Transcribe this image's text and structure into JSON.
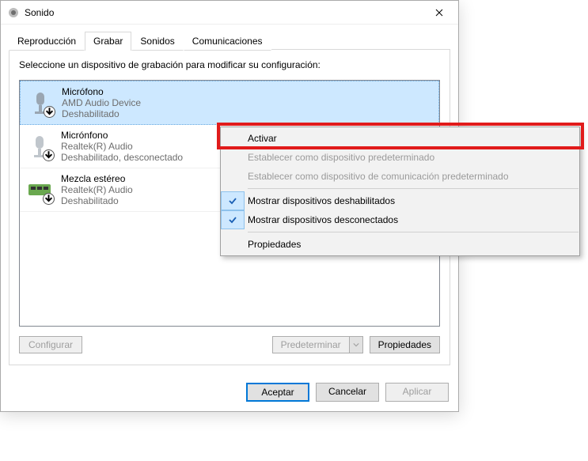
{
  "titlebar": {
    "title": "Sonido"
  },
  "tabs": [
    {
      "label": "Reproducción"
    },
    {
      "label": "Grabar"
    },
    {
      "label": "Sonidos"
    },
    {
      "label": "Comunicaciones"
    }
  ],
  "instruction": "Seleccione un dispositivo de grabación para modificar su configuración:",
  "devices": [
    {
      "name": "Micrófono",
      "line2": "AMD Audio Device",
      "line3": "Deshabilitado"
    },
    {
      "name": "Micrónfono",
      "line2": "Realtek(R) Audio",
      "line3": "Deshabilitado, desconectado"
    },
    {
      "name": "Mezcla estéreo",
      "line2": "Realtek(R) Audio",
      "line3": "Deshabilitado"
    }
  ],
  "panelButtons": {
    "configure": "Configurar",
    "setDefault": "Predeterminar",
    "properties": "Propiedades"
  },
  "dialogButtons": {
    "ok": "Aceptar",
    "cancel": "Cancelar",
    "apply": "Aplicar"
  },
  "contextMenu": {
    "activate": "Activar",
    "setDefault": "Establecer como dispositivo predeterminado",
    "setDefaultComm": "Establecer como dispositivo de comunicación predeterminado",
    "showDisabled": "Mostrar dispositivos deshabilitados",
    "showDisconnected": "Mostrar dispositivos desconectados",
    "properties": "Propiedades"
  }
}
